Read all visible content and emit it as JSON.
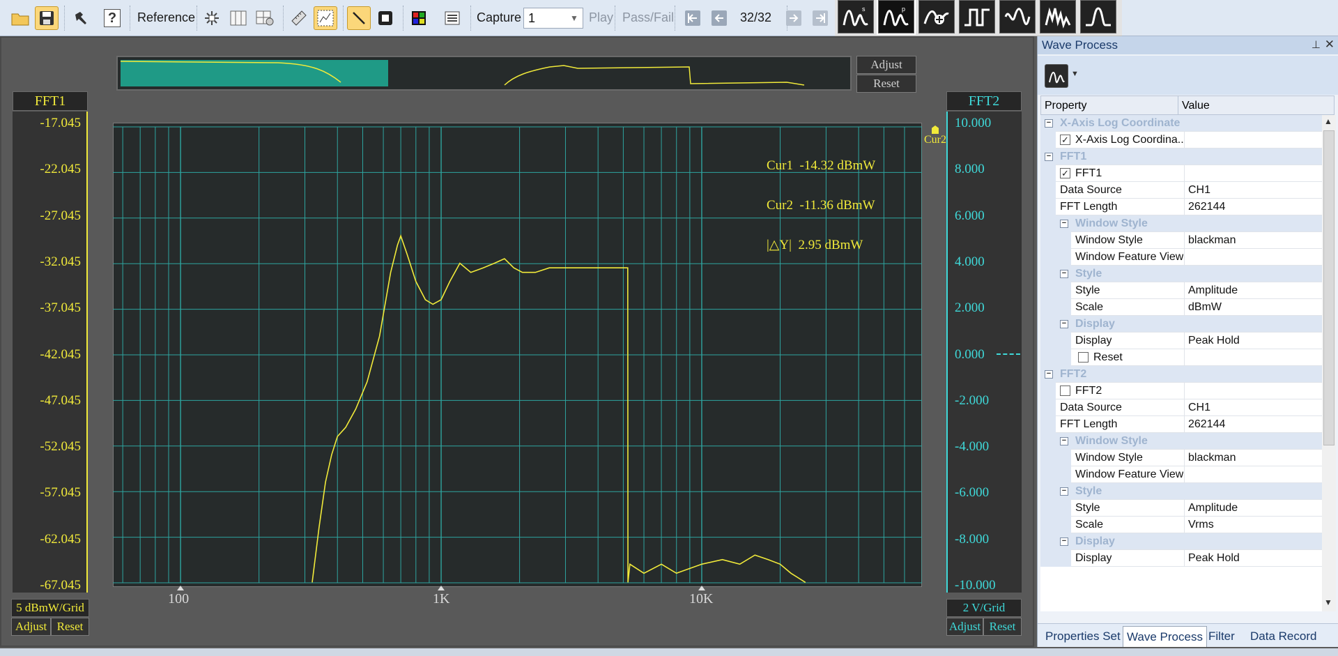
{
  "toolbar": {
    "reference_label": "Reference",
    "capture_label": "Capture",
    "capture_value": "1",
    "play_label": "Play",
    "passfail_label": "Pass/Fail",
    "frame_counter": "32/32",
    "help_label": "?"
  },
  "overview": {
    "adjust_label": "Adjust",
    "reset_label": "Reset"
  },
  "plot": {
    "left_channel": "FFT1",
    "right_channel": "FFT2",
    "left_scale": "5 dBmW/Grid",
    "right_scale": "2 V/Grid",
    "adjust_label": "Adjust",
    "reset_label": "Reset",
    "left_ticks": [
      "-17.045",
      "-22.045",
      "-27.045",
      "-32.045",
      "-37.045",
      "-42.045",
      "-47.045",
      "-52.045",
      "-57.045",
      "-62.045",
      "-67.045"
    ],
    "right_ticks": [
      "10.000",
      "8.000",
      "6.000",
      "4.000",
      "2.000",
      "0.000",
      "-2.000",
      "-4.000",
      "-6.000",
      "-8.000",
      "-10.000"
    ],
    "x_ticks": [
      "100",
      "1K",
      "10K"
    ],
    "cursor_marker": "Cur2",
    "cursor_lines": [
      "Cur1  -14.32 dBmW",
      "Cur2  -11.36 dBmW",
      "|△Y|  2.95 dBmW"
    ],
    "colors": {
      "trace": "#f1ea3a",
      "grid": "#2ea5a0",
      "background": "#262b2b"
    }
  },
  "chart_data": {
    "type": "line",
    "title": "",
    "xlabel": "",
    "ylabel": "",
    "x_scale": "log",
    "xlim": [
      55,
      70000
    ],
    "ylim": [
      -67.045,
      -17.045
    ],
    "series": [
      {
        "name": "FFT1",
        "x": [
          320,
          340,
          360,
          380,
          400,
          430,
          470,
          520,
          580,
          640,
          680,
          700,
          740,
          800,
          870,
          930,
          1000,
          1080,
          1180,
          1300,
          1450,
          1600,
          1750,
          1900,
          2050,
          2300,
          2600,
          3000,
          3500,
          4000,
          4600,
          5200,
          5210,
          5300,
          6000,
          7000,
          8000,
          10000,
          12000,
          14000,
          16000,
          18000,
          20000,
          22000,
          25000
        ],
        "y": [
          -67,
          -61,
          -56,
          -53,
          -51,
          -50,
          -48,
          -45,
          -40,
          -33,
          -30,
          -29,
          -31,
          -34,
          -36,
          -36.5,
          -36,
          -34,
          -32,
          -33,
          -32.5,
          -32,
          -31.5,
          -32.5,
          -33,
          -33,
          -32.5,
          -32.5,
          -32.5,
          -32.5,
          -32.5,
          -32.5,
          -67,
          -65,
          -66,
          -65,
          -66,
          -65,
          -64.5,
          -65,
          -64,
          -64.5,
          -65,
          -66,
          -67
        ]
      }
    ]
  },
  "panel": {
    "title": "Wave Process",
    "col_property": "Property",
    "col_value": "Value",
    "rows": [
      {
        "type": "cat",
        "level": 0,
        "name": "X-Axis Log Coordinate",
        "value": ""
      },
      {
        "type": "check",
        "level": 0,
        "name": "X-Axis Log Coordina...",
        "checked": true,
        "value": ""
      },
      {
        "type": "cat",
        "level": 0,
        "name": "FFT1",
        "value": ""
      },
      {
        "type": "check",
        "level": 0,
        "name": "FFT1",
        "checked": true,
        "value": ""
      },
      {
        "type": "prop",
        "level": 0,
        "name": "Data Source",
        "value": "CH1"
      },
      {
        "type": "prop",
        "level": 0,
        "name": "FFT Length",
        "value": "262144"
      },
      {
        "type": "cat",
        "level": 1,
        "name": "Window Style",
        "value": ""
      },
      {
        "type": "prop",
        "level": 1,
        "name": "Window Style",
        "value": "blackman"
      },
      {
        "type": "prop",
        "level": 1,
        "name": "Window Feature View",
        "value": ""
      },
      {
        "type": "cat",
        "level": 1,
        "name": "Style",
        "value": ""
      },
      {
        "type": "prop",
        "level": 1,
        "name": "Style",
        "value": "Amplitude"
      },
      {
        "type": "prop",
        "level": 1,
        "name": "Scale",
        "value": "dBmW"
      },
      {
        "type": "cat",
        "level": 1,
        "name": "Display",
        "value": ""
      },
      {
        "type": "prop",
        "level": 1,
        "name": "Display",
        "value": "Peak Hold"
      },
      {
        "type": "check",
        "level": 1,
        "name": "Reset",
        "checked": false,
        "value": ""
      },
      {
        "type": "cat",
        "level": 0,
        "name": "FFT2",
        "value": ""
      },
      {
        "type": "check",
        "level": 0,
        "name": "FFT2",
        "checked": false,
        "value": ""
      },
      {
        "type": "prop",
        "level": 0,
        "name": "Data Source",
        "value": "CH1"
      },
      {
        "type": "prop",
        "level": 0,
        "name": "FFT Length",
        "value": "262144"
      },
      {
        "type": "cat",
        "level": 1,
        "name": "Window Style",
        "value": ""
      },
      {
        "type": "prop",
        "level": 1,
        "name": "Window Style",
        "value": "blackman"
      },
      {
        "type": "prop",
        "level": 1,
        "name": "Window Feature View",
        "value": ""
      },
      {
        "type": "cat",
        "level": 1,
        "name": "Style",
        "value": ""
      },
      {
        "type": "prop",
        "level": 1,
        "name": "Style",
        "value": "Amplitude"
      },
      {
        "type": "prop",
        "level": 1,
        "name": "Scale",
        "value": "Vrms"
      },
      {
        "type": "cat",
        "level": 1,
        "name": "Display",
        "value": ""
      },
      {
        "type": "prop",
        "level": 1,
        "name": "Display",
        "value": "Peak Hold"
      }
    ],
    "tabs": [
      "Properties Set",
      "Wave Process",
      "Filter",
      "Data Record"
    ],
    "active_tab": 1
  }
}
